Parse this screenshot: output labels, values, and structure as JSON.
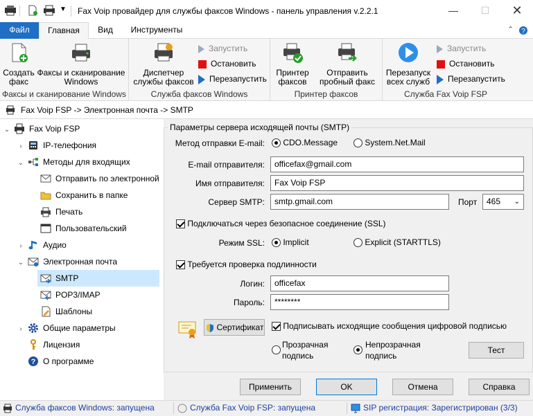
{
  "window": {
    "title": "Fax Voip провайдер для службы факсов Windows - панель управления v.2.2.1"
  },
  "ribbon_tabs": [
    {
      "label": "Файл"
    },
    {
      "label": "Главная"
    },
    {
      "label": "Вид"
    },
    {
      "label": "Инструменты"
    }
  ],
  "ribbon": {
    "group1": {
      "label": "Факсы и сканирование Windows",
      "create_fax": "Создать факс",
      "faxscan": "Факсы и сканирование Windows"
    },
    "group2": {
      "label": "Служба факсов Windows",
      "dispatcher": "Диспетчер службы факсов",
      "start": "Запустить",
      "stop": "Остановить",
      "restart": "Перезапустить"
    },
    "group3": {
      "label": "Принтер факсов",
      "printer": "Принтер факсов",
      "test_fax": "Отправить пробный факс"
    },
    "group4": {
      "label": "Служба Fax Voip FSP",
      "restart_all": "Перезапуск всех служб",
      "start": "Запустить",
      "stop": "Остановить",
      "restart": "Перезапустить"
    }
  },
  "address": "Fax Voip FSP -> Электронная почта -> SMTP",
  "tree": [
    {
      "label": "Fax Voip FSP"
    },
    {
      "label": "IP-телефония"
    },
    {
      "label": "Методы для входящих"
    },
    {
      "label": "Отправить по электронной"
    },
    {
      "label": "Сохранить в папке"
    },
    {
      "label": "Печать"
    },
    {
      "label": "Пользовательский"
    },
    {
      "label": "Аудио"
    },
    {
      "label": "Электронная почта"
    },
    {
      "label": "SMTP"
    },
    {
      "label": "POP3/IMAP"
    },
    {
      "label": "Шаблоны"
    },
    {
      "label": "Общие параметры"
    },
    {
      "label": "Лицензия"
    },
    {
      "label": "О программе"
    }
  ],
  "smtp": {
    "group_title": "Параметры сервера исходящей почты (SMTP)",
    "method_label": "Метод отправки E-mail:",
    "method_options": [
      "CDO.Message",
      "System.Net.Mail"
    ],
    "sender_email_label": "E-mail отправителя:",
    "sender_email": "officefax@gmail.com",
    "sender_name_label": "Имя отправителя:",
    "sender_name": "Fax Voip FSP",
    "server_label": "Сервер SMTP:",
    "server": "smtp.gmail.com",
    "port_label": "Порт",
    "port": "465",
    "ssl_check": "Подключаться через безопасное соединение (SSL)",
    "ssl_mode_label": "Режим SSL:",
    "ssl_modes": [
      "Implicit",
      "Explicit (STARTTLS)"
    ],
    "auth_check": "Требуется проверка подлинности",
    "login_label": "Логин:",
    "login": "officefax",
    "password_label": "Пароль:",
    "password": "********",
    "cert_button": "Сертификат",
    "sign_check": "Подписывать исходящие сообщения цифровой подписью",
    "sign_transparent": "Прозрачная подпись",
    "sign_opaque": "Непрозрачная подпись",
    "test_button": "Тест"
  },
  "buttons": {
    "apply": "Применить",
    "ok": "OK",
    "cancel": "Отмена",
    "help": "Справка"
  },
  "status": {
    "fax_service": "Служба факсов Windows: запущена",
    "fsp_service": "Служба Fax Voip FSP: запущена",
    "sip": "SIP регистрация: Зарегистрирован (3/3)"
  },
  "colors": {
    "accent": "#1e6fc5",
    "selection": "#cce8ff",
    "status_text": "#1e3e9e"
  }
}
